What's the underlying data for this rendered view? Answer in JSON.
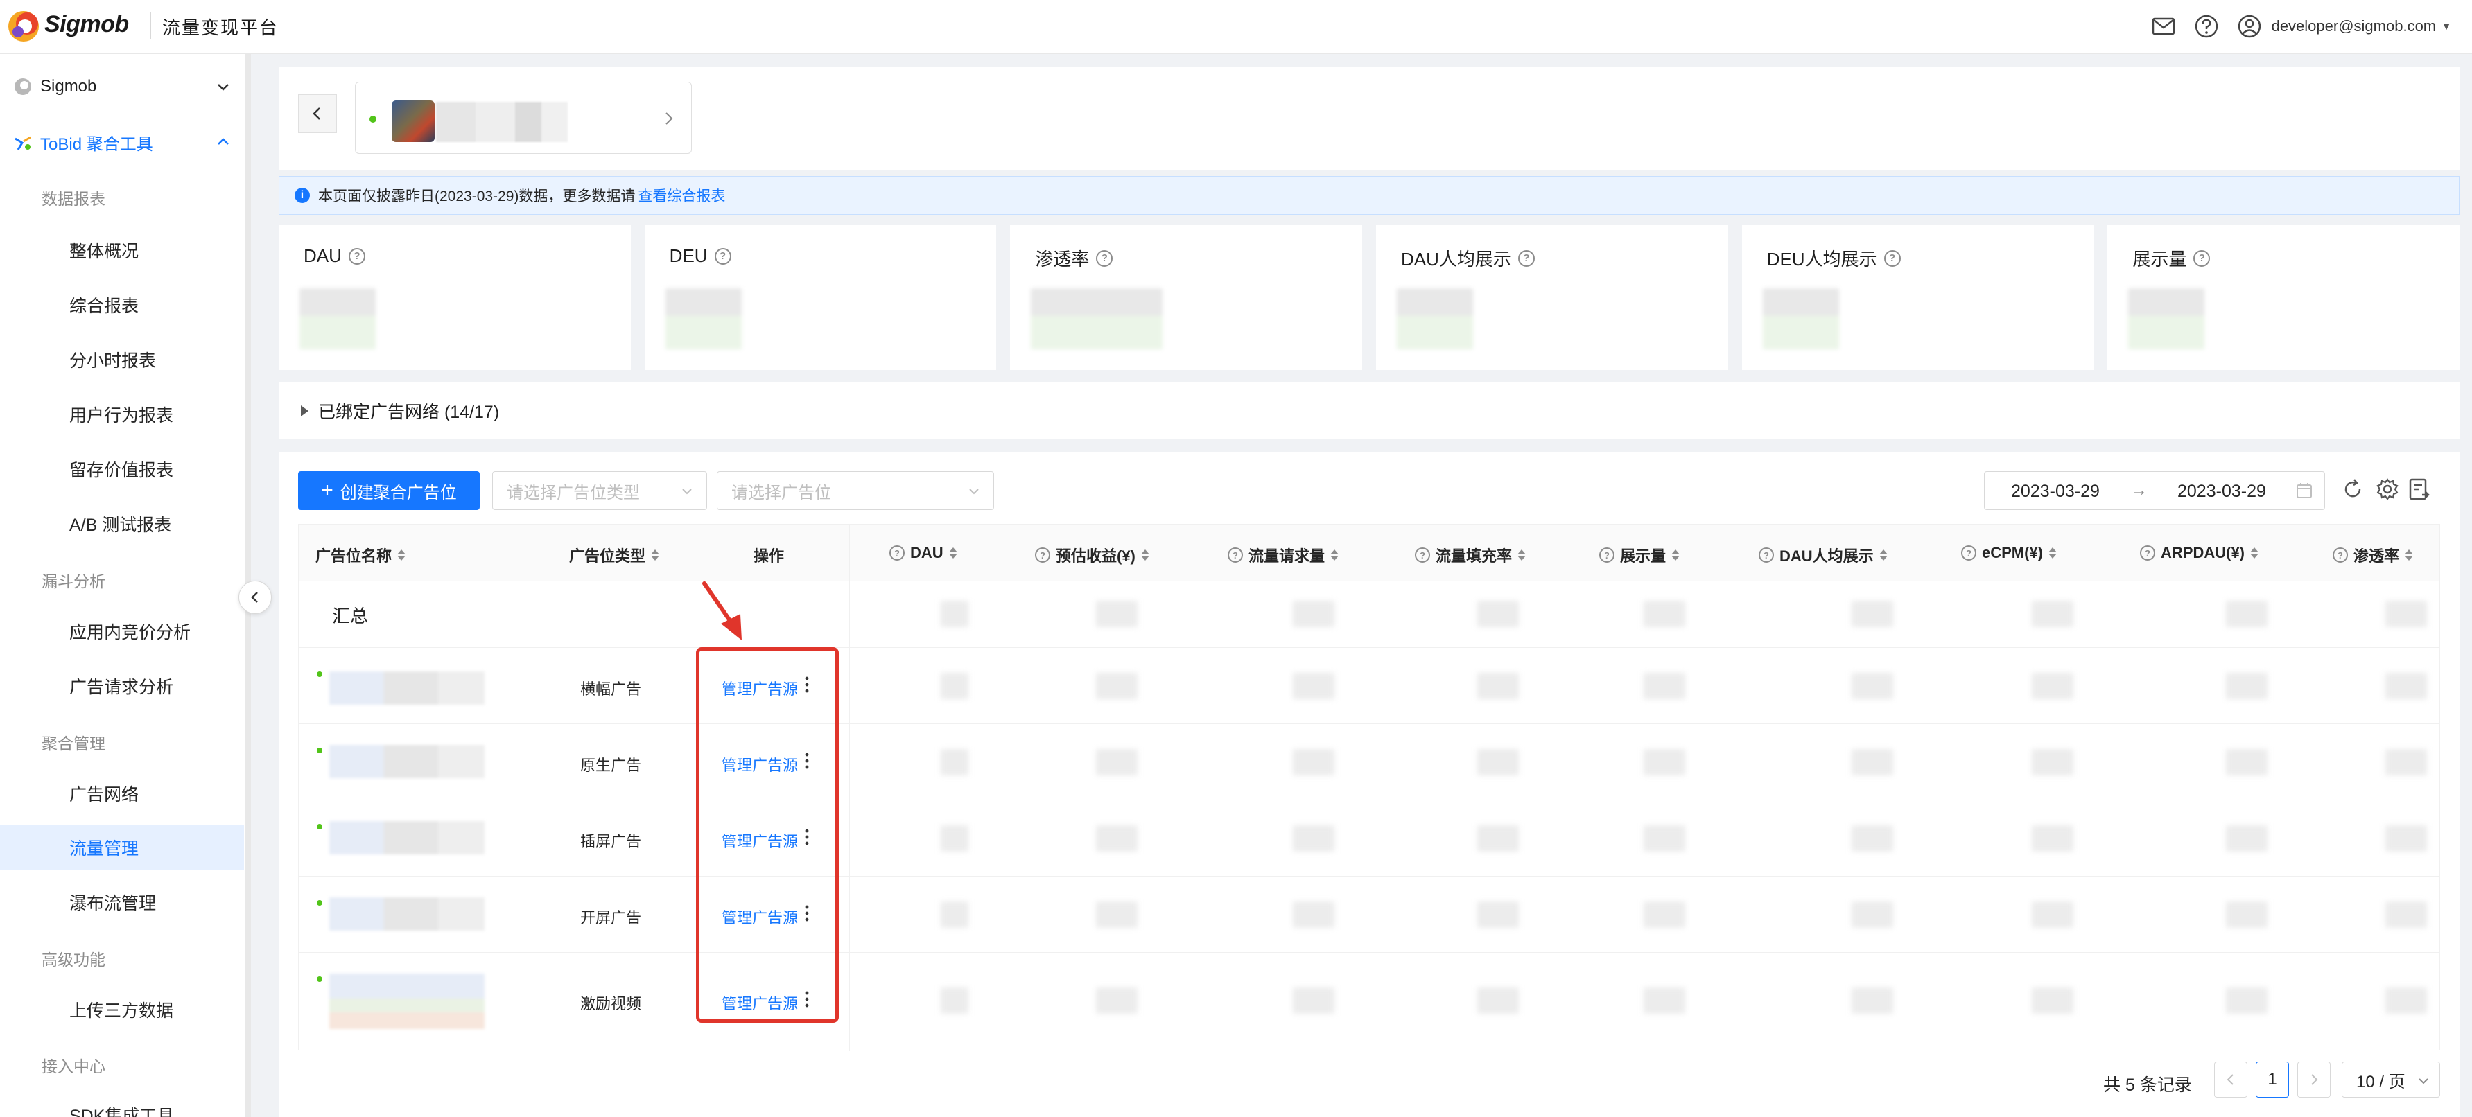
{
  "header": {
    "brand": "Sigmob",
    "platform": "流量变现平台",
    "user_email": "developer@sigmob.com"
  },
  "sidebar": {
    "groups": [
      {
        "label": "Sigmob",
        "expanded": false
      },
      {
        "label": "ToBid 聚合工具",
        "expanded": true
      }
    ],
    "sections": {
      "data_reports": "数据报表",
      "funnel": "漏斗分析",
      "aggregation": "聚合管理",
      "advanced": "高级功能",
      "access": "接入中心"
    },
    "items": [
      {
        "label": "整体概况"
      },
      {
        "label": "综合报表"
      },
      {
        "label": "分小时报表"
      },
      {
        "label": "用户行为报表"
      },
      {
        "label": "留存价值报表"
      },
      {
        "label": "A/B 测试报表"
      },
      {
        "label": "应用内竞价分析"
      },
      {
        "label": "广告请求分析"
      },
      {
        "label": "广告网络"
      },
      {
        "label": "流量管理",
        "active": true
      },
      {
        "label": "瀑布流管理"
      },
      {
        "label": "上传三方数据"
      },
      {
        "label": "SDK集成工具"
      }
    ]
  },
  "notice": {
    "text": "本页面仅披露昨日(2023-03-29)数据，更多数据请",
    "link": "查看综合报表"
  },
  "metrics": [
    {
      "label": "DAU"
    },
    {
      "label": "DEU"
    },
    {
      "label": "渗透率"
    },
    {
      "label": "DAU人均展示"
    },
    {
      "label": "DEU人均展示"
    },
    {
      "label": "展示量"
    }
  ],
  "networks": {
    "label": "已绑定广告网络 (14/17)"
  },
  "toolbar": {
    "create_label": "创建聚合广告位",
    "type_placeholder": "请选择广告位类型",
    "slot_placeholder": "请选择广告位",
    "date_start": "2023-03-29",
    "date_end": "2023-03-29"
  },
  "table": {
    "columns": [
      "广告位名称",
      "广告位类型",
      "操作",
      "DAU",
      "预估收益(¥)",
      "流量请求量",
      "流量填充率",
      "展示量",
      "DAU人均展示",
      "eCPM(¥)",
      "ARPDAU(¥)",
      "渗透率"
    ],
    "summary_label": "汇总",
    "manage_label": "管理广告源",
    "rows": [
      {
        "type": "横幅广告"
      },
      {
        "type": "原生广告"
      },
      {
        "type": "插屏广告"
      },
      {
        "type": "开屏广告"
      },
      {
        "type": "激励视频"
      }
    ]
  },
  "pagination": {
    "total": "共 5 条记录",
    "current": "1",
    "page_size": "10 / 页"
  },
  "colors": {
    "accent": "#1677ff",
    "highlight": "#e0352b",
    "status_dot": "#52c41a"
  }
}
